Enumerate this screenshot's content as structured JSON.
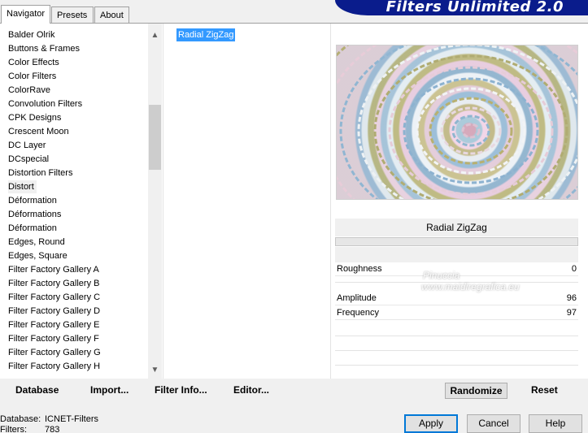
{
  "tabs": [
    "Navigator",
    "Presets",
    "About"
  ],
  "banner": {
    "title": "Filters Unlimited 2.0"
  },
  "navigator": {
    "items": [
      "Balder Olrik",
      "Buttons & Frames",
      "Color Effects",
      "Color Filters",
      "ColorRave",
      "Convolution Filters",
      "CPK Designs",
      "Crescent Moon",
      "DC Layer",
      "DCspecial",
      "Distortion Filters",
      "Distort",
      "Déformation",
      "Déformations",
      "Déformation",
      "Edges, Round",
      "Edges, Square",
      "Filter Factory Gallery A",
      "Filter Factory Gallery B",
      "Filter Factory Gallery C",
      "Filter Factory Gallery D",
      "Filter Factory Gallery E",
      "Filter Factory Gallery F",
      "Filter Factory Gallery G",
      "Filter Factory Gallery H"
    ],
    "selected_index": 11
  },
  "filters": {
    "items": [
      "Radial ZigZag"
    ]
  },
  "preview": {
    "filter_name": "Radial ZigZag"
  },
  "params": [
    {
      "label": "Roughness",
      "value": "0"
    },
    {
      "label": "Amplitude",
      "value": "96"
    },
    {
      "label": "Frequency",
      "value": "97"
    }
  ],
  "bottom_bar": {
    "database": "Database",
    "import": "Import...",
    "filter_info": "Filter Info...",
    "editor": "Editor...",
    "randomize": "Randomize",
    "reset": "Reset"
  },
  "footer": {
    "database_label": "Database:",
    "database_value": "ICNET-Filters",
    "filters_label": "Filters:",
    "filters_value": "783"
  },
  "dialog": {
    "apply": "Apply",
    "cancel": "Cancel",
    "help": "Help"
  },
  "watermark": {
    "line1": "Pinuccia",
    "line2": "www.maidiregrafica.eu"
  },
  "colors": {
    "selection": "#3399ff",
    "banner": "#0a1c8c",
    "focus": "#0078d7"
  }
}
